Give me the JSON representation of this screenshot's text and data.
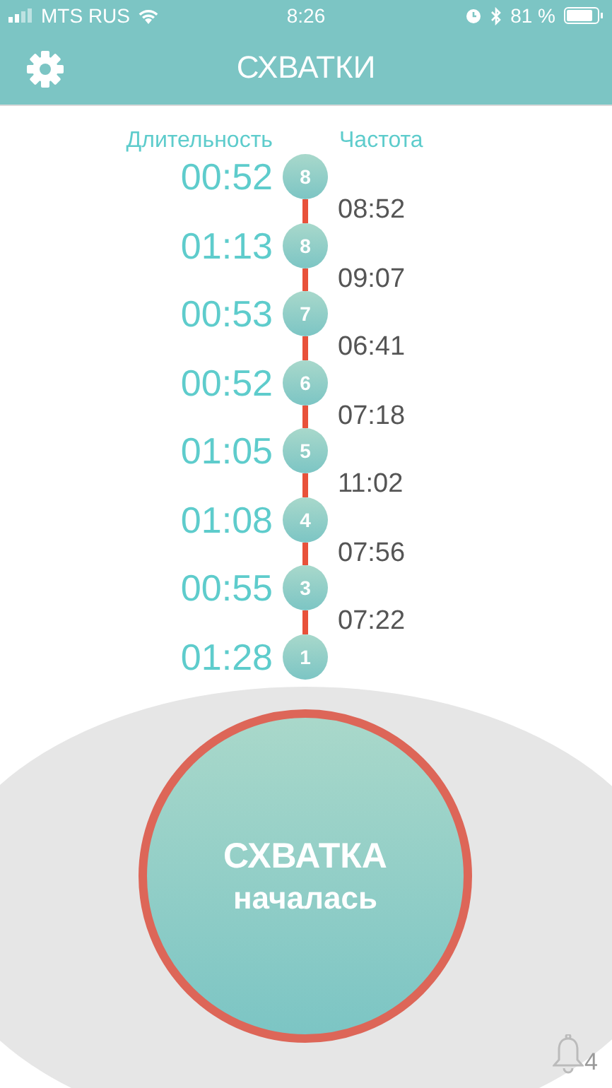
{
  "status_bar": {
    "carrier": "MTS RUS",
    "time": "8:26",
    "battery": "81 %"
  },
  "nav": {
    "title": "СХВАТКИ"
  },
  "columns": {
    "duration": "Длительность",
    "frequency": "Частота"
  },
  "contractions": [
    {
      "number": "8",
      "duration": "00:52",
      "interval_after": "08:52"
    },
    {
      "number": "8",
      "duration": "01:13",
      "interval_after": "09:07"
    },
    {
      "number": "7",
      "duration": "00:53",
      "interval_after": "06:41"
    },
    {
      "number": "6",
      "duration": "00:52",
      "interval_after": "07:18"
    },
    {
      "number": "5",
      "duration": "01:05",
      "interval_after": "11:02"
    },
    {
      "number": "4",
      "duration": "01:08",
      "interval_after": "07:56"
    },
    {
      "number": "3",
      "duration": "00:55",
      "interval_after": "07:22"
    },
    {
      "number": "1",
      "duration": "01:28"
    }
  ],
  "start_button": {
    "line_1": "СХВАТКА",
    "line_2": "началась"
  },
  "notifications": {
    "count": "4"
  }
}
